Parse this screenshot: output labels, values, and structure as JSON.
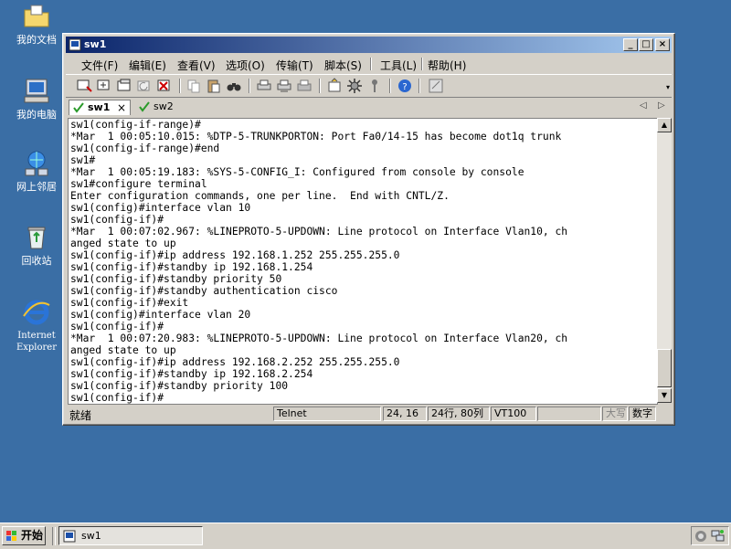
{
  "desktop": {
    "icons": [
      {
        "label": "我的文档",
        "icon": "folder-icon"
      },
      {
        "label": "我的电脑",
        "icon": "computer-icon"
      },
      {
        "label": "网上邻居",
        "icon": "network-icon"
      },
      {
        "label": "回收站",
        "icon": "recycle-bin-icon"
      },
      {
        "label": "Internet Explorer",
        "icon": "ie-icon"
      }
    ]
  },
  "window": {
    "title": "sw1",
    "menu": [
      "文件(F)",
      "编辑(E)",
      "查看(V)",
      "选项(O)",
      "传输(T)",
      "脚本(S)",
      "工具(L)",
      "帮助(H)"
    ],
    "tabs": [
      {
        "label": "sw1",
        "active": true,
        "close": "×"
      },
      {
        "label": "sw2",
        "active": false
      }
    ],
    "tab_nav": {
      "prev": "◁",
      "next": "▷"
    },
    "terminal_lines": [
      "sw1(config-if-range)#",
      "*Mar  1 00:05:10.015: %DTP-5-TRUNKPORTON: Port Fa0/14-15 has become dot1q trunk",
      "sw1(config-if-range)#end",
      "sw1#",
      "*Mar  1 00:05:19.183: %SYS-5-CONFIG_I: Configured from console by console",
      "sw1#configure terminal",
      "Enter configuration commands, one per line.  End with CNTL/Z.",
      "sw1(config)#interface vlan 10",
      "sw1(config-if)#",
      "*Mar  1 00:07:02.967: %LINEPROTO-5-UPDOWN: Line protocol on Interface Vlan10, ch",
      "anged state to up",
      "sw1(config-if)#ip address 192.168.1.252 255.255.255.0",
      "sw1(config-if)#standby ip 192.168.1.254",
      "sw1(config-if)#standby priority 50",
      "sw1(config-if)#standby authentication cisco",
      "sw1(config-if)#exit",
      "sw1(config)#interface vlan 20",
      "sw1(config-if)#",
      "*Mar  1 00:07:20.983: %LINEPROTO-5-UPDOWN: Line protocol on Interface Vlan20, ch",
      "anged state to up",
      "sw1(config-if)#ip address 192.168.2.252 255.255.255.0",
      "sw1(config-if)#standby ip 192.168.2.254",
      "sw1(config-if)#standby priority 100",
      "sw1(config-if)#"
    ],
    "status": {
      "ready": "就绪",
      "protocol": "Telnet",
      "cursor": "24, 16",
      "size": "24行, 80列",
      "emulation": "VT100",
      "caps": "大写",
      "num": "数字"
    }
  },
  "taskbar": {
    "start_label": "开始",
    "task_label": "sw1"
  }
}
